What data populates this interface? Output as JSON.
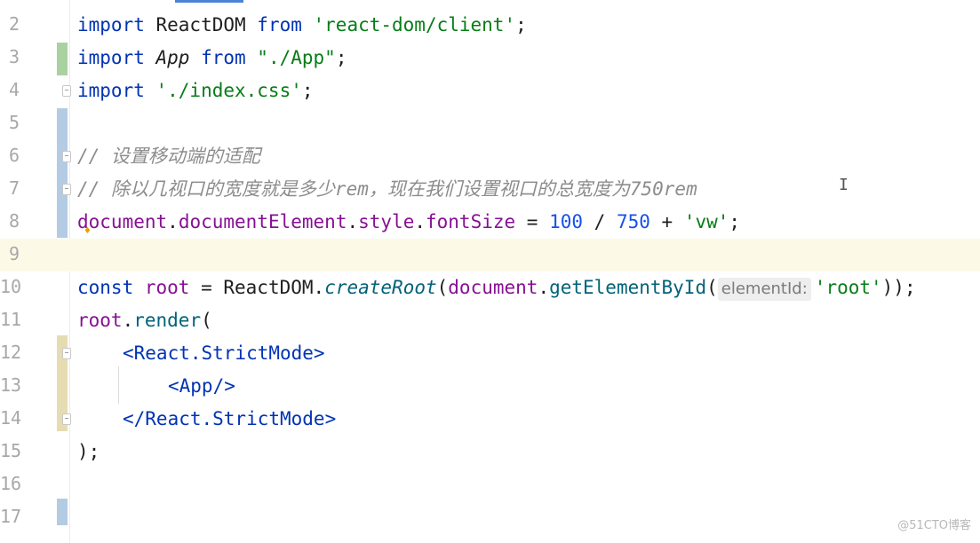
{
  "editor": {
    "lines": [
      {
        "number": "2"
      },
      {
        "number": "3"
      },
      {
        "number": "4"
      },
      {
        "number": "5"
      },
      {
        "number": "6"
      },
      {
        "number": "7"
      },
      {
        "number": "8"
      },
      {
        "number": "9"
      },
      {
        "number": "10"
      },
      {
        "number": "11"
      },
      {
        "number": "12"
      },
      {
        "number": "13"
      },
      {
        "number": "14"
      },
      {
        "number": "15"
      },
      {
        "number": "16"
      },
      {
        "number": "17"
      }
    ],
    "tokens": {
      "l2_import": "import",
      "l2_reactdom": " ReactDOM ",
      "l2_from": "from",
      "l2_str": " 'react-dom/client'",
      "l2_semi": ";",
      "l3_import": "import",
      "l3_app": " App ",
      "l3_from": "from",
      "l3_str": " \"./App\"",
      "l3_semi": ";",
      "l4_import": "import",
      "l4_str": " './index.css'",
      "l4_semi": ";",
      "l6_comment": "// 设置移动端的适配",
      "l7_comment": "// 除以几视口的宽度就是多少rem，现在我们设置视口的总宽度为750rem",
      "l8_document": "document",
      "l8_dot1": ".",
      "l8_docel": "documentElement",
      "l8_dot2": ".",
      "l8_style": "style",
      "l8_dot3": ".",
      "l8_fontsize": "fontSize",
      "l8_eq": " = ",
      "l8_n100": "100",
      "l8_div": " / ",
      "l8_n750": "750",
      "l8_plus": " + ",
      "l8_vw": "'vw'",
      "l8_semi": ";",
      "l10_const": "const",
      "l10_root": " root",
      "l10_eq": " = ",
      "l10_reactdom": "ReactDOM",
      "l10_dot": ".",
      "l10_createroot": "createRoot",
      "l10_paren": "(",
      "l10_document": "document",
      "l10_dot2": ".",
      "l10_getbyid": "getElementById",
      "l10_paren2": "(",
      "l10_hint": "elementId:",
      "l10_str": "'root'",
      "l10_close": "));",
      "l11_root": "root",
      "l11_dot": ".",
      "l11_render": "render",
      "l11_paren": "(",
      "l12_open": "<React.StrictMode>",
      "l13_app": "<App/>",
      "l14_close": "</React.StrictMode>",
      "l15_close": ");"
    }
  },
  "cursor_glyph": "I",
  "bulb_glyph": "♦",
  "watermark": "@51CTO博客",
  "colors": {
    "keyword": "#0033b3",
    "string": "#067d17",
    "number": "#1750eb",
    "comment": "#8c8c8c",
    "current_line": "#fcfae7"
  }
}
